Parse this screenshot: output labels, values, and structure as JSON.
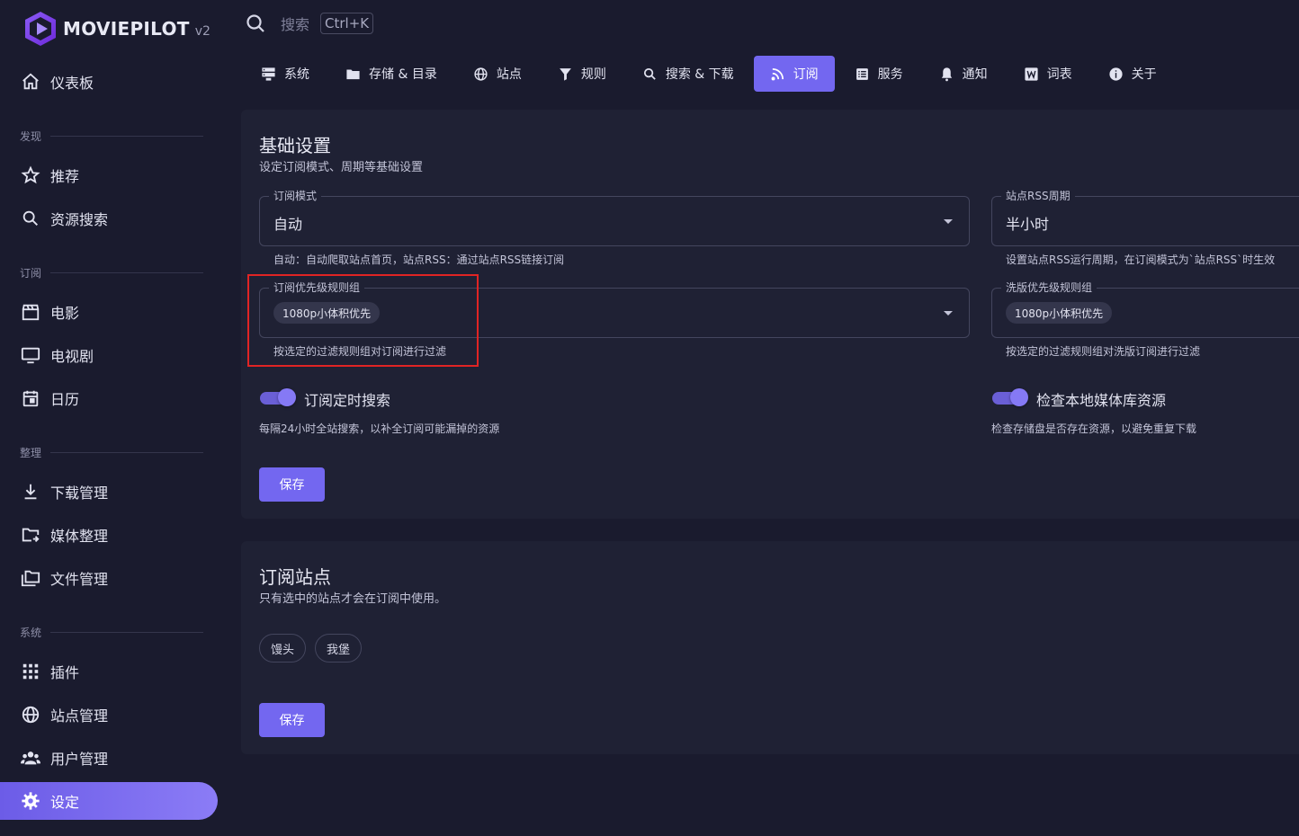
{
  "app": {
    "name": "MOVIEPILOT",
    "version": "v2"
  },
  "sidebar": {
    "dashboard": "仪表板",
    "sections": {
      "discover": "发现",
      "subscribe": "订阅",
      "organize": "整理",
      "system": "系统"
    },
    "items": [
      {
        "label": "推荐",
        "icon": "star-icon"
      },
      {
        "label": "资源搜索",
        "icon": "search-icon"
      },
      {
        "label": "电影",
        "icon": "clapperboard-icon"
      },
      {
        "label": "电视剧",
        "icon": "tv-icon"
      },
      {
        "label": "日历",
        "icon": "calendar-icon"
      },
      {
        "label": "下载管理",
        "icon": "download-icon"
      },
      {
        "label": "媒体整理",
        "icon": "folder-move-icon"
      },
      {
        "label": "文件管理",
        "icon": "folders-icon"
      },
      {
        "label": "插件",
        "icon": "grid-icon"
      },
      {
        "label": "站点管理",
        "icon": "globe-icon"
      },
      {
        "label": "用户管理",
        "icon": "users-icon"
      },
      {
        "label": "设定",
        "icon": "gear-icon",
        "active": true
      }
    ]
  },
  "search": {
    "placeholder": "搜索",
    "shortcut": "Ctrl+K"
  },
  "tabs": [
    {
      "label": "系统"
    },
    {
      "label": "存储 & 目录"
    },
    {
      "label": "站点"
    },
    {
      "label": "规则"
    },
    {
      "label": "搜索 & 下载"
    },
    {
      "label": "订阅",
      "active": true
    },
    {
      "label": "服务"
    },
    {
      "label": "通知"
    },
    {
      "label": "词表"
    },
    {
      "label": "关于"
    }
  ],
  "basic": {
    "title": "基础设置",
    "subtitle": "设定订阅模式、周期等基础设置",
    "mode": {
      "label": "订阅模式",
      "value": "自动",
      "hint": "自动：自动爬取站点首页，站点RSS：通过站点RSS链接订阅"
    },
    "rss": {
      "label": "站点RSS周期",
      "value": "半小时",
      "hint": "设置站点RSS运行周期，在订阅模式为`站点RSS`时生效"
    },
    "priority": {
      "label": "订阅优先级规则组",
      "chip": "1080p小体积优先",
      "hint": "按选定的过滤规则组对订阅进行过滤"
    },
    "wash": {
      "label": "洗版优先级规则组",
      "chip": "1080p小体积优先",
      "hint": "按选定的过滤规则组对洗版订阅进行过滤"
    },
    "timed_search": {
      "label": "订阅定时搜索",
      "hint": "每隔24小时全站搜索，以补全订阅可能漏掉的资源",
      "on": true
    },
    "check_local": {
      "label": "检查本地媒体库资源",
      "hint": "检查存储盘是否存在资源，以避免重复下载",
      "on": true
    },
    "save": "保存"
  },
  "sites": {
    "title": "订阅站点",
    "subtitle": "只有选中的站点才会在订阅中使用。",
    "chips": [
      "馒头",
      "我堡"
    ],
    "save": "保存"
  },
  "colors": {
    "accent": "#7367f0",
    "background": "#1a1b2e",
    "card": "#1f2134",
    "highlight": "#e02424"
  }
}
